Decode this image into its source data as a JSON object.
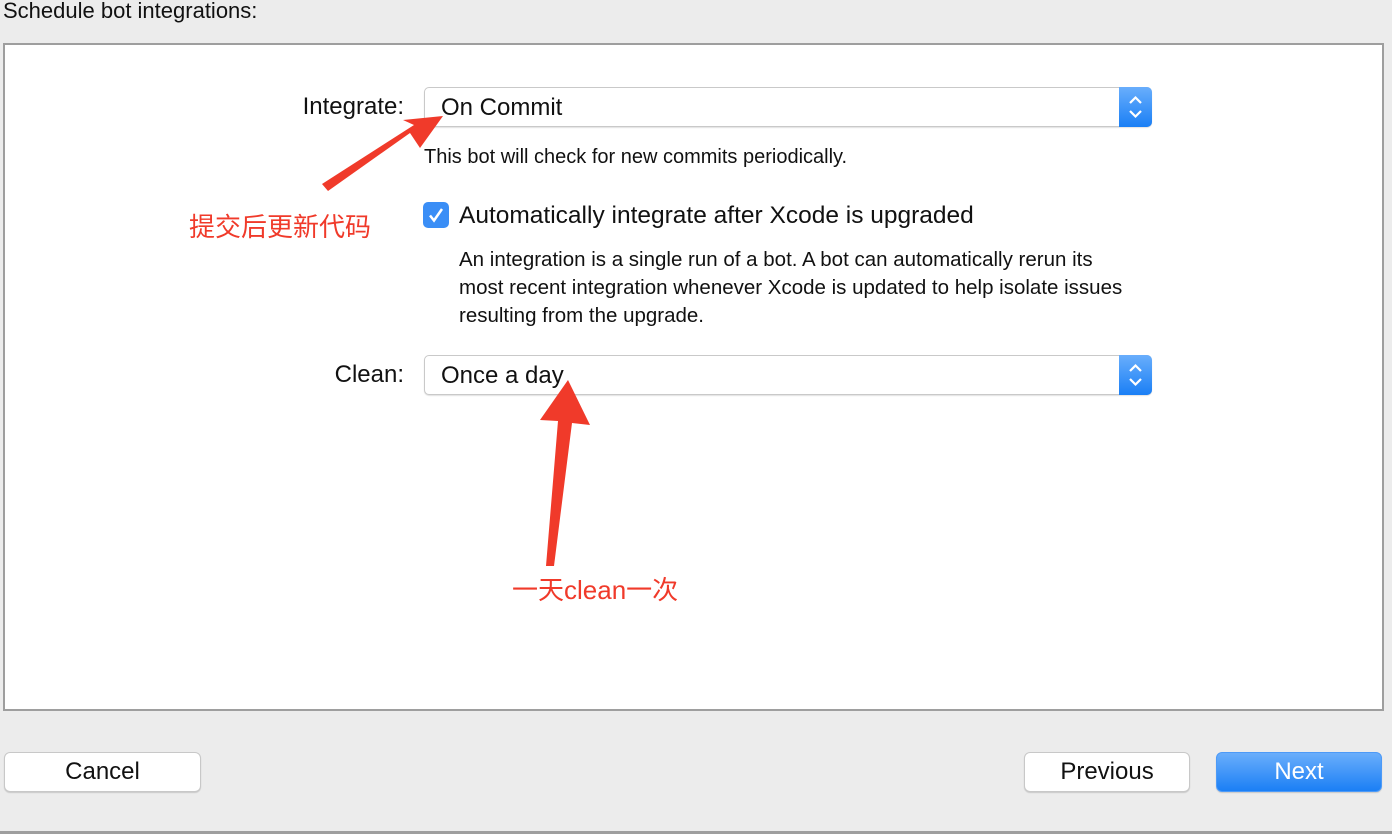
{
  "title": "Schedule bot integrations:",
  "integrate": {
    "label": "Integrate:",
    "value": "On Commit",
    "note": "This bot will check for new commits periodically."
  },
  "auto_integrate": {
    "checked": true,
    "label": "Automatically integrate after Xcode is upgraded",
    "description": "An integration is a single run of a bot. A bot can automatically rerun its most recent integration whenever Xcode is updated to help isolate issues resulting from the upgrade."
  },
  "clean": {
    "label": "Clean:",
    "value": "Once a day"
  },
  "annotations": {
    "integrate": "提交后更新代码",
    "clean": "一天clean一次"
  },
  "buttons": {
    "cancel": "Cancel",
    "previous": "Previous",
    "next": "Next"
  },
  "colors": {
    "accent": "#1a7ff5",
    "annotation": "#f03a2a"
  }
}
